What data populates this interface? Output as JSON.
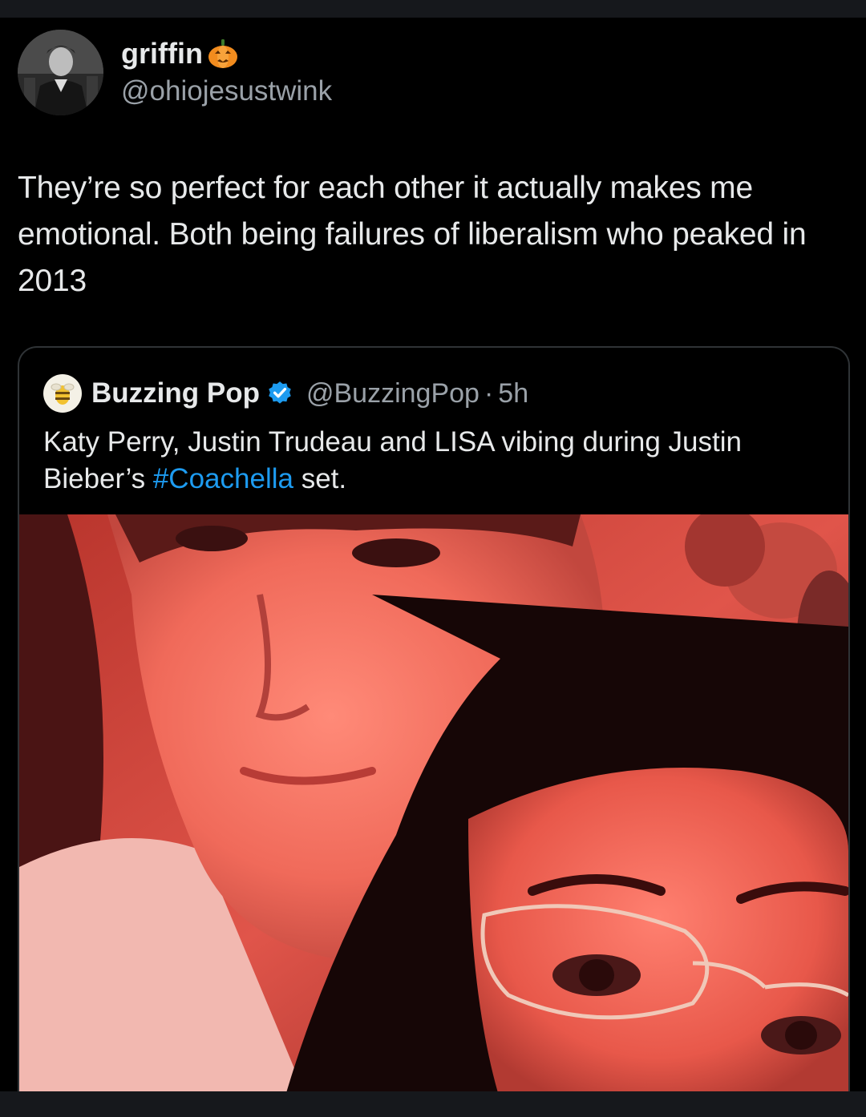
{
  "author": {
    "display_name": "griffin",
    "name_emoji": "pumpkin-icon",
    "handle": "@ohiojesustwink"
  },
  "tweet": {
    "text": "They’re so perfect for each other it actually makes me emotional. Both being failures of liberalism who peaked in 2013"
  },
  "quoted_tweet": {
    "display_name": "Buzzing Pop",
    "verified": true,
    "handle": "@BuzzingPop",
    "separator": "·",
    "time": "5h",
    "text_before": "Katy Perry, Justin Trudeau and LISA vibing during Justin Bieber’s ",
    "hashtag": "#Coachella",
    "text_after": " set.",
    "media": "photo"
  },
  "colors": {
    "background": "#000000",
    "text_primary": "#e7e9ea",
    "text_secondary": "#9aa1a8",
    "link": "#1d9bf0",
    "verified": "#1d9bf0",
    "border": "#2f3336"
  }
}
